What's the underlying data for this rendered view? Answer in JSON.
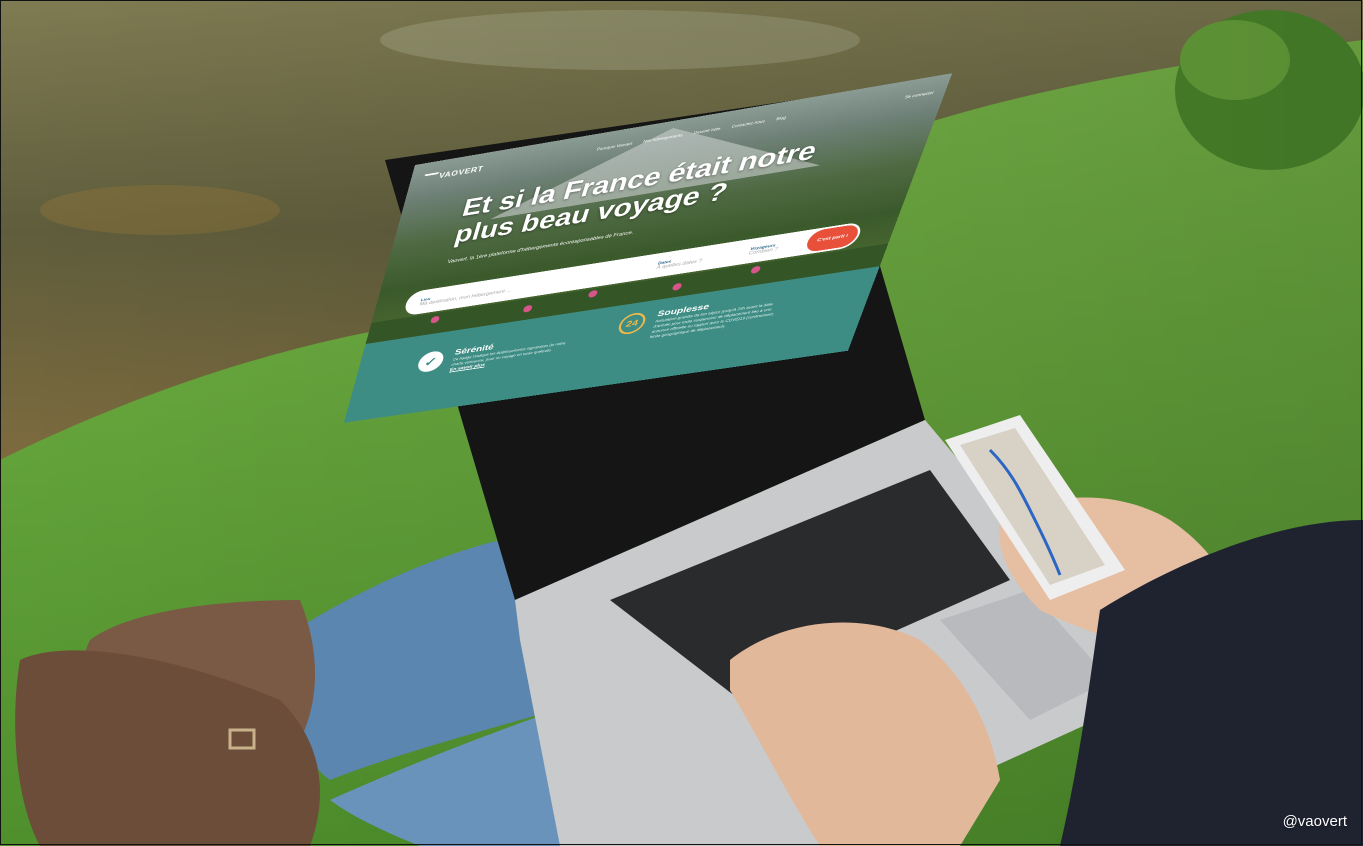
{
  "site": {
    "logo": "VAOVERT",
    "nav": [
      "Pourquoi Vaovert",
      "Nos hébergements",
      "Devenir hôte",
      "Contactez-nous",
      "Blog"
    ],
    "login": "Se connecter",
    "headline": "Et si la France était notre plus beau voyage ?",
    "tagline": "Vaovert, la 1ère plateforme d'hébergements écoresponsables de France.",
    "search": {
      "lieu_label": "Lieu",
      "lieu_placeholder": "Ma destination, mon hébergement ...",
      "dates_label": "Dates",
      "dates_placeholder": "À quelles dates ?",
      "voyageurs_label": "Voyageurs",
      "voyageurs_placeholder": "Combien ?",
      "cta": "C'est parti !"
    },
    "features": [
      {
        "title": "Sérénité",
        "text": "Ce badge t'indique les établissements signataires de notre charte vertueuse, pour un voyage en toute quiétude.",
        "link": "En savoir plus",
        "icon": "check-badge-icon"
      },
      {
        "title": "Souplesse",
        "text": "Annulation gratuite de ton séjour jusqu'à 24h avant la date d'arrivée pour toute suspension de déplacement liée à une annonce officielle ou rapport avec le COVID19 (confinement, limite géographique de déplacement).",
        "icon": "24h-icon"
      }
    ]
  },
  "watermark": "@vaovert",
  "colors": {
    "teal": "#3e8d84",
    "cta": "#e8503a",
    "accent_24": "#f0b94a",
    "grass": "#5fa33a",
    "water": "#6d6b45",
    "jeans": "#5b86b0",
    "boots": "#7a5a45"
  }
}
